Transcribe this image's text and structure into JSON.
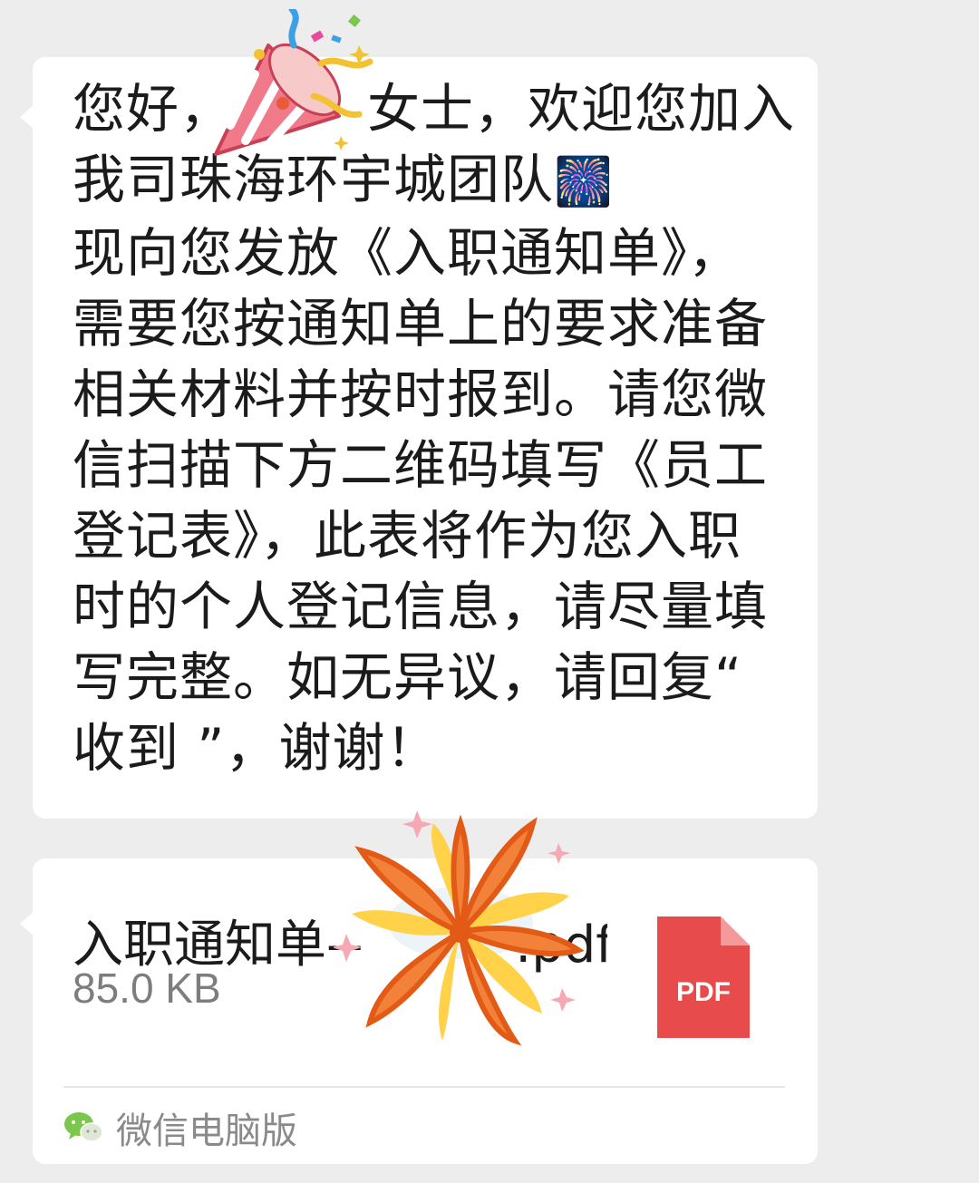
{
  "message": {
    "lines": [
      "您好，　　　女士，欢迎您加入",
      "我司珠海环宇城团队",
      "现向您发放《入职通知单》，",
      "需要您按通知单上的要求准备",
      "相关材料并按时报到。请您微",
      "信扫描下方二维码填写《员工",
      "登记表》，此表将作为您入职",
      "时的个人登记信息，请尽量填",
      "写完整。如无异议，请回复“",
      "收到 ”，谢谢！"
    ],
    "fireworks_emoji": "🎆"
  },
  "file": {
    "name": "入职通知单--　　　.pdf",
    "size": "85.0 KB",
    "icon_label": "PDF",
    "icon_color": "#e84b4b",
    "source": "微信电脑版"
  },
  "stickers": [
    "party-popper-sticker",
    "firework-sticker"
  ]
}
